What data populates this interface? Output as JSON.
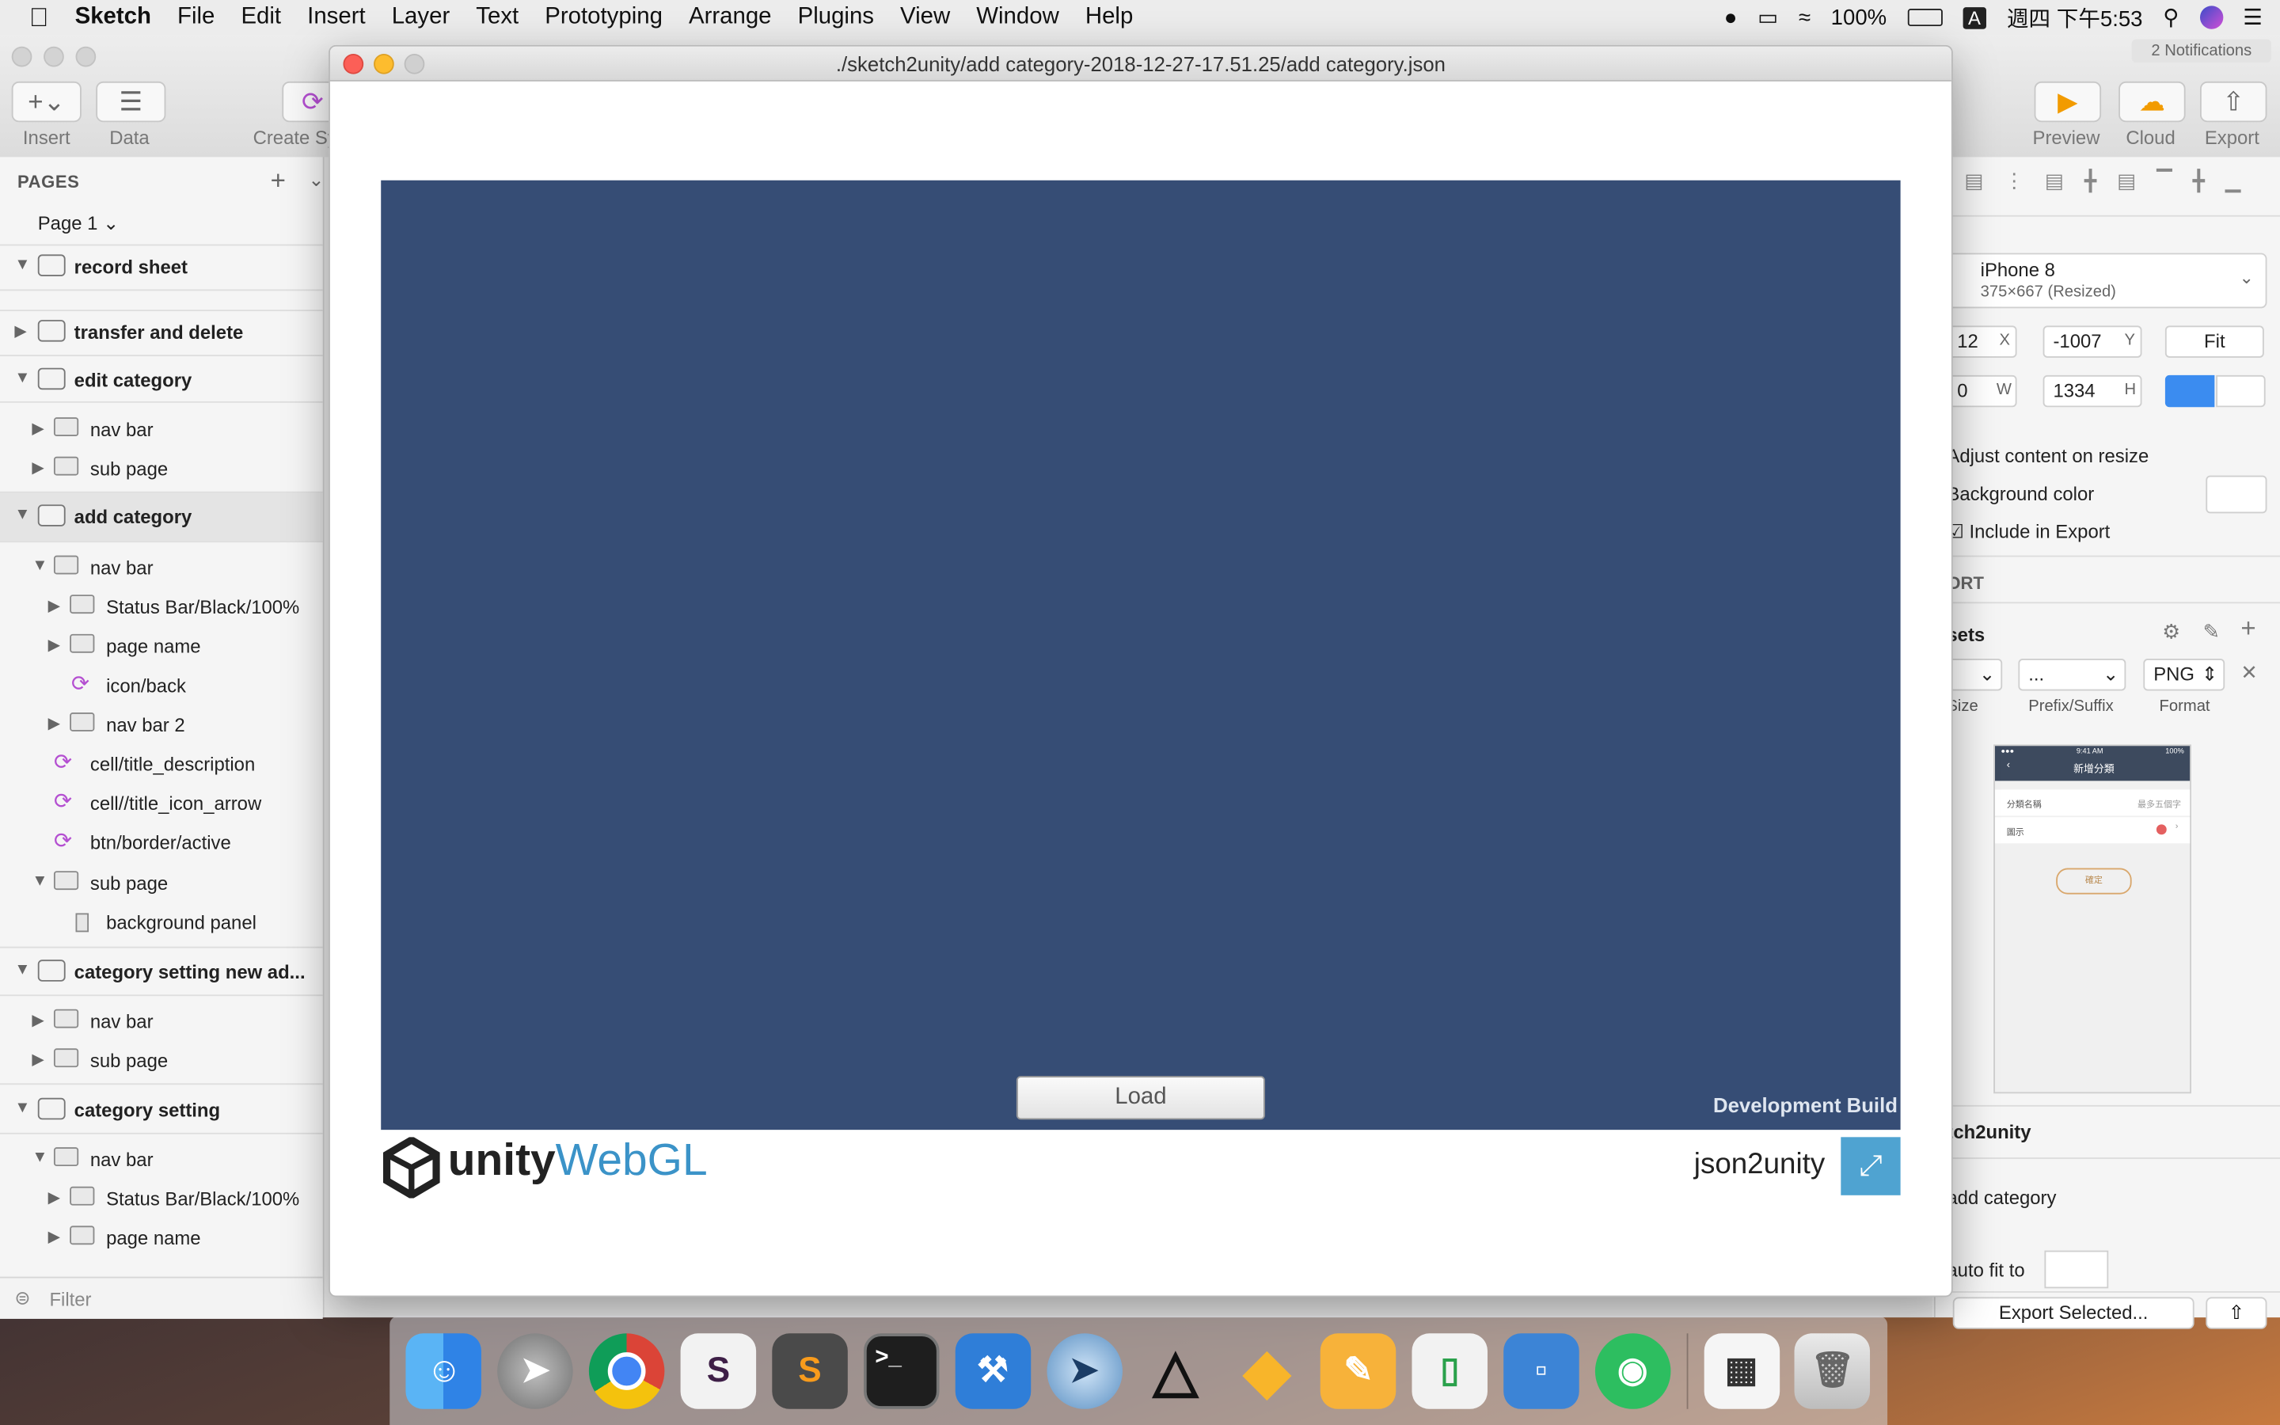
{
  "menubar": {
    "app_name": "Sketch",
    "items": [
      "File",
      "Edit",
      "Insert",
      "Layer",
      "Text",
      "Prototyping",
      "Arrange",
      "Plugins",
      "View",
      "Window",
      "Help"
    ],
    "battery": "100%",
    "input_method": "A",
    "clock": "週四 下午5:53"
  },
  "notifications": "2 Notifications",
  "toolbar": {
    "insert_label": "Insert",
    "data_label": "Data",
    "create_symbol_label": "Create Sy",
    "preview_label": "Preview",
    "cloud_label": "Cloud",
    "export_label": "Export"
  },
  "sidebar": {
    "pages_header": "PAGES",
    "current_page": "Page 1",
    "filter_placeholder": "Filter",
    "layers": [
      {
        "label": "record sheet"
      },
      {
        "label": "transfer and delete"
      },
      {
        "label": "edit category"
      },
      {
        "label": "nav bar"
      },
      {
        "label": "sub page"
      },
      {
        "label": "add category"
      },
      {
        "label": "nav bar"
      },
      {
        "label": "Status Bar/Black/100%"
      },
      {
        "label": "page name"
      },
      {
        "label": "icon/back"
      },
      {
        "label": "nav bar 2"
      },
      {
        "label": "cell/title_description"
      },
      {
        "label": "cell//title_icon_arrow"
      },
      {
        "label": "btn/border/active"
      },
      {
        "label": "sub page"
      },
      {
        "label": "background panel"
      },
      {
        "label": "category setting new ad..."
      },
      {
        "label": "nav bar"
      },
      {
        "label": "sub page"
      },
      {
        "label": "category setting"
      },
      {
        "label": "nav bar"
      },
      {
        "label": "Status Bar/Black/100%"
      },
      {
        "label": "page name"
      }
    ]
  },
  "inspector": {
    "device_name": "iPhone 8",
    "device_size": "375×667 (Resized)",
    "x_value": "12",
    "x_label": "X",
    "y_value": "-1007",
    "y_label": "Y",
    "fit_label": "Fit",
    "w_value": "0",
    "w_label": "W",
    "h_value": "1334",
    "h_label": "H",
    "adjust_label": "Adjust content on resize",
    "bgcolor_label": "Background color",
    "include_label": "Include in Export",
    "export_section": "ORT",
    "presets_label": "sets",
    "prefix_value": "...",
    "format_value": "PNG",
    "size_col": "Size",
    "prefix_col": "Prefix/Suffix",
    "format_col": "Format",
    "plugin_title": "tch2unity",
    "artboard_name": "add category",
    "autofit_label": "auto fit to",
    "export_selected": "Export Selected..."
  },
  "thumbnail": {
    "title": "新增分類",
    "row1_left": "分類名稱",
    "row1_right": "最多五個字",
    "row2_left": "圖示",
    "button": "確定",
    "status_time": "9:41 AM",
    "battery": "100%"
  },
  "unity_window": {
    "title": "./sketch2unity/add category-2018-12-27-17.51.25/add category.json",
    "load_button": "Load",
    "dev_build": "Development Build",
    "logo_unity": "unity",
    "logo_webgl": "WebGL",
    "project_name": "json2unity"
  },
  "colors": {
    "unity_canvas": "#364d75",
    "webgl_blue": "#3b93c8",
    "fullscreen_btn": "#4fa3d1",
    "symbol_purple": "#b44fd1"
  },
  "dock": {
    "apps": [
      "finder-icon",
      "launchpad-icon",
      "chrome-icon",
      "slack-icon",
      "sublime-text-icon",
      "terminal-icon",
      "xcode-icon",
      "remote-desktop-icon",
      "unity-icon",
      "sketch-icon",
      "pages-icon",
      "numbers-icon",
      "keynote-icon",
      "evernote-icon",
      "clipboard-icon",
      "trash-icon"
    ]
  }
}
